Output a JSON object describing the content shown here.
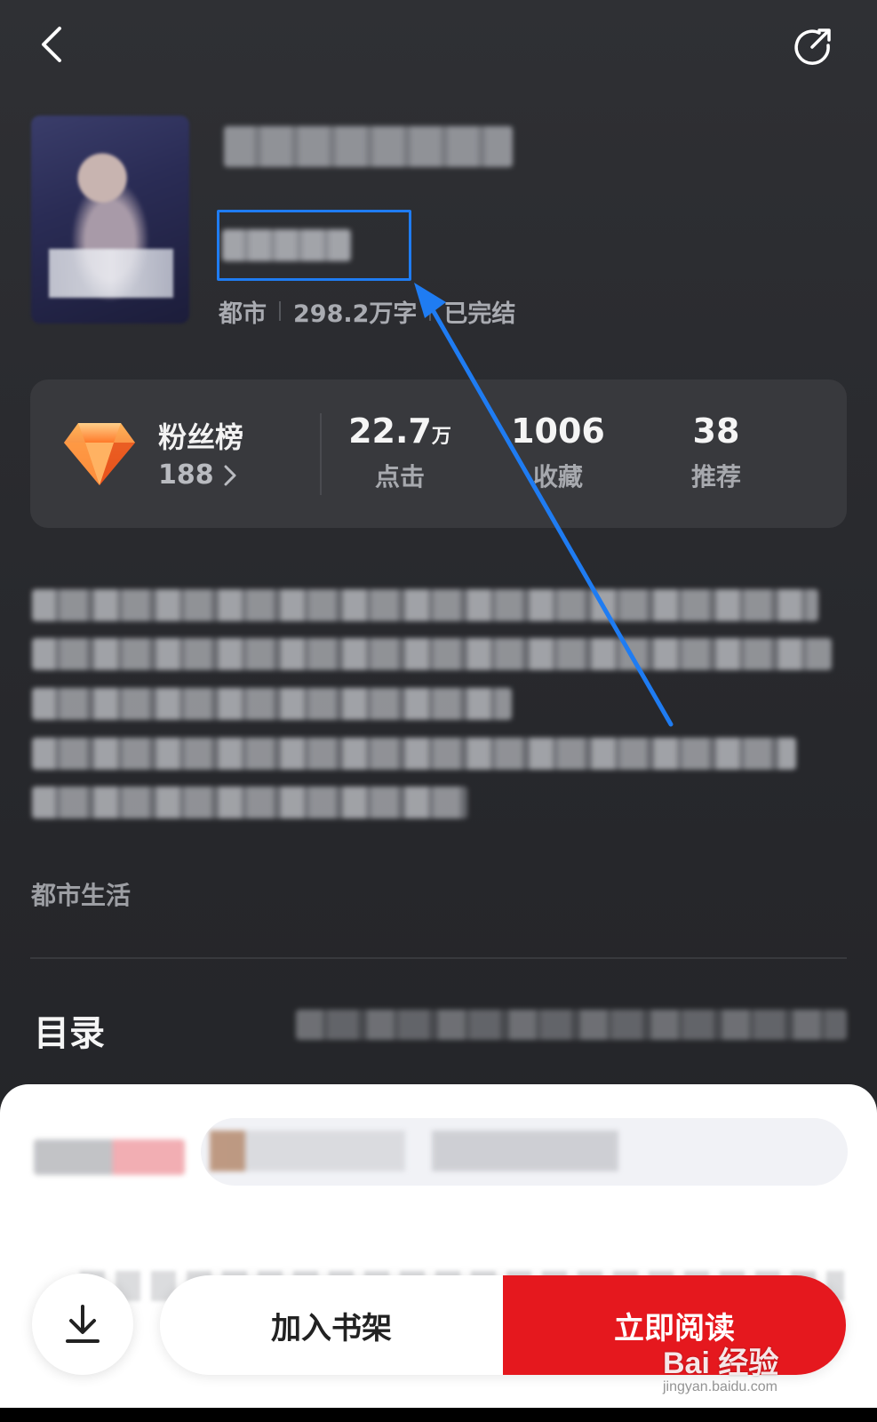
{
  "header": {
    "back_icon": "chevron-left-icon",
    "share_icon": "share-icon"
  },
  "book": {
    "meta": {
      "category": "都市",
      "word_count": "298.2万字",
      "status": "已完结"
    }
  },
  "stats": {
    "fans": {
      "title": "粉丝榜",
      "count": "188"
    },
    "clicks": {
      "value": "22.7",
      "unit": "万",
      "label": "点击"
    },
    "favorites": {
      "value": "1006",
      "label": "收藏"
    },
    "recommends": {
      "value": "38",
      "label": "推荐"
    }
  },
  "tag": "都市生活",
  "toc": {
    "title": "目录"
  },
  "actions": {
    "add_to_shelf": "加入书架",
    "read_now": "立即阅读"
  },
  "watermark": {
    "main": "Bai 经验",
    "sub": "jingyan.baidu.com"
  },
  "colors": {
    "highlight": "#1f7cf2",
    "read_button": "#e5181e",
    "background": "#2a2b2f"
  }
}
